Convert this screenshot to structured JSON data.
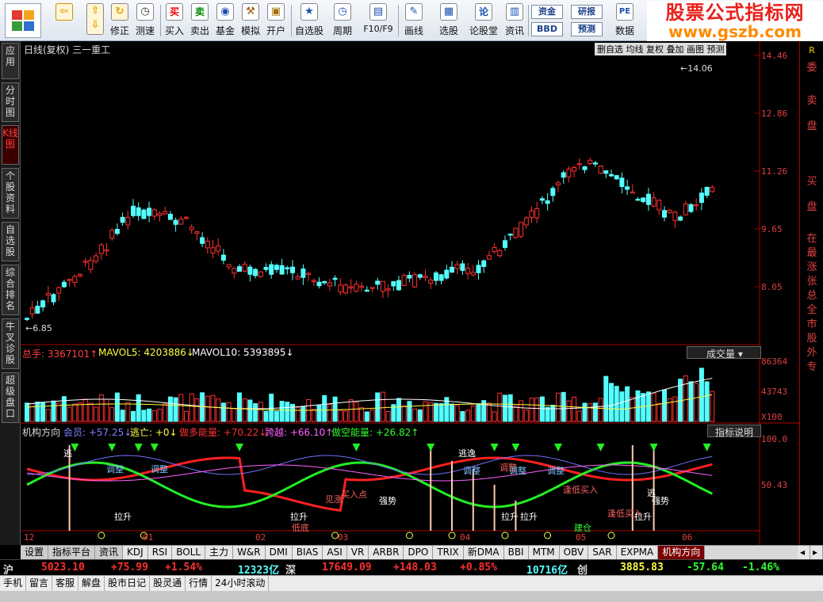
{
  "toolbar": {
    "buttons": [
      {
        "name": "back",
        "label": "",
        "icon": "back-arrow-icon"
      },
      {
        "name": "updown",
        "label": "",
        "icon": "up-down-arrows-icon"
      },
      {
        "name": "fix",
        "label": "修正",
        "icon": "fix-icon"
      },
      {
        "name": "test",
        "label": "测速",
        "icon": "clock-icon"
      },
      {
        "name": "buy",
        "label": "买入",
        "glyph": "买"
      },
      {
        "name": "sell",
        "label": "卖出",
        "glyph": "卖"
      },
      {
        "name": "fund",
        "label": "基金",
        "glyph": "◉"
      },
      {
        "name": "sim",
        "label": "模拟",
        "glyph": "⚒"
      },
      {
        "name": "open",
        "label": "开户",
        "glyph": "🔒"
      },
      {
        "name": "selfpick",
        "label": "自选股",
        "glyph": "★"
      },
      {
        "name": "period",
        "label": "周期",
        "glyph": "◷"
      },
      {
        "name": "f10",
        "label": "F10/F9",
        "glyph": "▤"
      },
      {
        "name": "draw",
        "label": "画线",
        "glyph": "✎"
      },
      {
        "name": "pick",
        "label": "选股",
        "glyph": "▦"
      },
      {
        "name": "forum",
        "label": "论股堂",
        "glyph": "论"
      },
      {
        "name": "news",
        "label": "资讯",
        "glyph": "▥"
      },
      {
        "name": "data",
        "label": "数据",
        "glyph": "PE"
      }
    ],
    "small": {
      "zijin": "资金",
      "bbd": "BBD",
      "yanbao": "研报",
      "yuce": "预测"
    }
  },
  "brand": {
    "title": "股票公式指标网",
    "url": "www.gszb.com"
  },
  "left_tabs": [
    "应用",
    "分时图",
    "K线图",
    "个股资料",
    "自选股",
    "综合排名",
    "牛叉诊股",
    "超级盘口"
  ],
  "chart": {
    "title": "日线(复权)  三一重工",
    "top_right_menu": "删自选  均线  复权  叠加  画图  预测",
    "price_axis": [
      "14.46",
      "12.86",
      "11.26",
      "9.65",
      "8.05"
    ],
    "high_label": "14.06",
    "low_label": "6.85",
    "volume_header": {
      "total_label": "总手: 3367101↑",
      "mavol5_label": "MAVOL5: 4203886↓",
      "mavol10_label": "MAVOL10: 5393895↓"
    },
    "volume_selector": "成交量",
    "volume_axis": [
      "86364",
      "43743",
      "X100"
    ],
    "indicator_header": {
      "name": "机构方向",
      "member": "会员: +57.25↓",
      "escape": "逃亡: +0↓",
      "bull": "做多能量: +70.22↓",
      "cross": "跨越: +66.10↑",
      "bear": "做空能量: +26.82↑"
    },
    "indicator_button": "指标说明",
    "indicator_axis": [
      "100.0",
      "50.43"
    ],
    "date_labels": [
      "12",
      "01",
      "02",
      "03",
      "04",
      "05",
      "06"
    ],
    "annotations": [
      "逃",
      "调整",
      "调整",
      "拉升",
      "见涨",
      "买入点",
      "强势",
      "拉升",
      "低底",
      "逃逸",
      "调整",
      "调整",
      "调整",
      "调整",
      "拉升",
      "拉升",
      "逢低买入",
      "逢低买入",
      "逃",
      "强势",
      "拉升",
      "建仓"
    ]
  },
  "right_panel": [
    "R",
    "委",
    "卖",
    "盘",
    "买",
    "盘",
    "在",
    "最",
    "涨",
    "张",
    "总",
    "全",
    "市",
    "股",
    "外",
    "专"
  ],
  "bottom_tabs": [
    "设置",
    "指标平台",
    "资讯",
    "KDJ",
    "RSI",
    "BOLL",
    "主力",
    "W&R",
    "DMI",
    "BIAS",
    "ASI",
    "VR",
    "ARBR",
    "DPO",
    "TRIX",
    "新DMA",
    "BBI",
    "MTM",
    "OBV",
    "SAR",
    "EXPMA",
    "机构方向"
  ],
  "status": {
    "sh_label": "沪",
    "sh_index": "5023.10",
    "sh_change": "+75.99",
    "sh_pct": "+1.54%",
    "sh_amount": "12323亿",
    "sz_label": "深",
    "sz_index": "17649.09",
    "sz_change": "+148.03",
    "sz_pct": "+0.85%",
    "sz_amount": "10716亿",
    "cy_label": "创",
    "cy_index": "3885.83",
    "cy_change": "-57.64",
    "cy_pct": "-1.46%"
  },
  "bottom_menu": [
    "手机",
    "留言",
    "客服",
    "解盘",
    "股市日记",
    "股灵通",
    "行情",
    "24小时滚动"
  ],
  "colors": {
    "up": "#ff3030",
    "down": "#54ffff",
    "ma5": "#ffffff",
    "ma10": "#ffff00",
    "green": "#22ee22"
  }
}
